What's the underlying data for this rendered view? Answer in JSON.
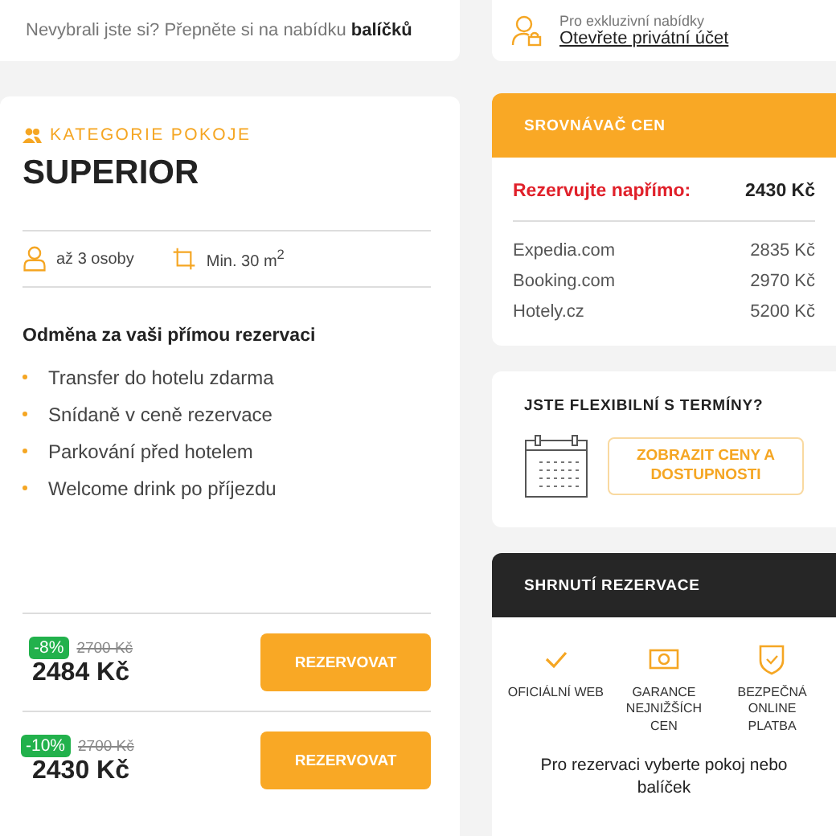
{
  "top_banner": {
    "text": "Nevybrali jste si? Přepněte si na nabídku **balíčků**"
  },
  "private_account": {
    "caption": "Pro exkluzivní nabídky",
    "link": "Otevřete privátní účet"
  },
  "room": {
    "category": "KATEGORIE POKOJE",
    "name": "SUPERIOR",
    "features": [
      {
        "kind": "persons",
        "text": "až 3 osoby"
      },
      {
        "kind": "area",
        "text": "Min. 30 m$^{2}$"
      }
    ],
    "reward_title": "Odměna za vaši přímou rezervaci",
    "rewards": [
      "Transfer do hotelu zdarma",
      "Snídaně v ceně rezervace",
      "Parkování před hotelem",
      "Welcome drink po příjezdu"
    ],
    "offers": [
      {
        "discount": "-8%",
        "old_price": "2700 Kč",
        "price": "2484 Kč",
        "button": "REZERVOVAT"
      },
      {
        "discount": "-10%",
        "old_price": "2700 Kč",
        "price": "2430 Kč",
        "button": "REZERVOVAT"
      }
    ]
  },
  "price_comparison": {
    "title": "SROVNÁVAČ CEN",
    "direct_label": "Rezervujte napřímo:",
    "direct_price": "2430 Kč",
    "rows": [
      {
        "site": "Expedia.com",
        "price": "2835 Kč"
      },
      {
        "site": "Booking.com",
        "price": "2970 Kč"
      },
      {
        "site": "Hotely.cz",
        "price": "5200 Kč"
      }
    ]
  },
  "flexible": {
    "title": "JSTE FLEXIBILNÍ S TERMÍNY?",
    "button": "ZOBRAZIT CENY A DOSTUPNOSTI"
  },
  "summary": {
    "title": "SHRNUTÍ REZERVACE",
    "badges": [
      {
        "kind": "check",
        "label": "OFICIÁLNÍ WEB"
      },
      {
        "kind": "money",
        "label": "GARANCE NEJNIŽŠÍCH CEN"
      },
      {
        "kind": "shield",
        "label": "BEZPEČNÁ ONLINE PLATBA"
      }
    ],
    "note": "Pro rezervaci vyberte pokoj nebo balíček"
  }
}
